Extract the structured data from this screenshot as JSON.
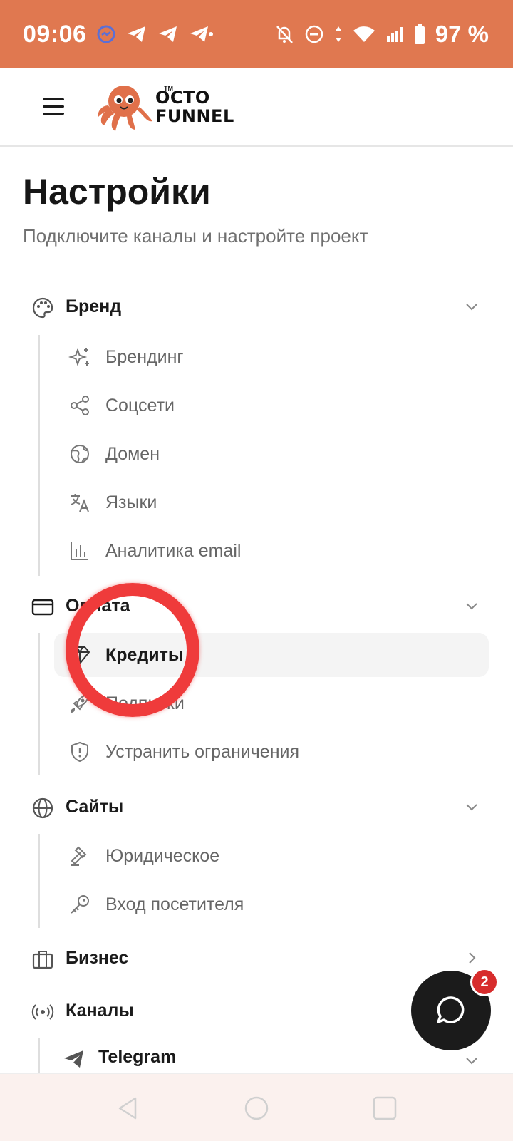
{
  "status_bar": {
    "time": "09:06",
    "battery_text": "97 %"
  },
  "header": {
    "logo_line1": "OCTO",
    "logo_line2": "FUNNEL",
    "logo_tm": "TM"
  },
  "page": {
    "title": "Настройки",
    "subtitle": "Подключите каналы и настройте проект"
  },
  "nav": {
    "sections": [
      {
        "label": "Бренд",
        "icon": "palette-icon",
        "items": [
          {
            "label": "Брендинг",
            "icon": "sparkles-icon"
          },
          {
            "label": "Соцсети",
            "icon": "share-icon"
          },
          {
            "label": "Домен",
            "icon": "globe-grid-icon"
          },
          {
            "label": "Языки",
            "icon": "translate-icon"
          },
          {
            "label": "Аналитика email",
            "icon": "bar-chart-icon"
          }
        ]
      },
      {
        "label": "Оплата",
        "icon": "credit-card-icon",
        "items": [
          {
            "label": "Кредиты",
            "icon": "gem-icon",
            "active": true
          },
          {
            "label": "Подписки",
            "icon": "rocket-icon"
          },
          {
            "label": "Устранить ограничения",
            "icon": "shield-icon"
          }
        ]
      },
      {
        "label": "Сайты",
        "icon": "globe-icon",
        "items": [
          {
            "label": "Юридическое",
            "icon": "gavel-icon"
          },
          {
            "label": "Вход посетителя",
            "icon": "key-icon"
          }
        ]
      },
      {
        "label": "Бизнес",
        "icon": "briefcase-icon",
        "items": []
      },
      {
        "label": "Каналы",
        "icon": "broadcast-icon",
        "items": [
          {
            "label": "Telegram",
            "icon": "telegram-icon"
          }
        ]
      }
    ]
  },
  "chat": {
    "badge_count": "2"
  },
  "colors": {
    "status_bar": "#e07850",
    "annotation": "#ef3b3b",
    "fab": "#1b1b1b",
    "badge": "#d72c2c"
  }
}
